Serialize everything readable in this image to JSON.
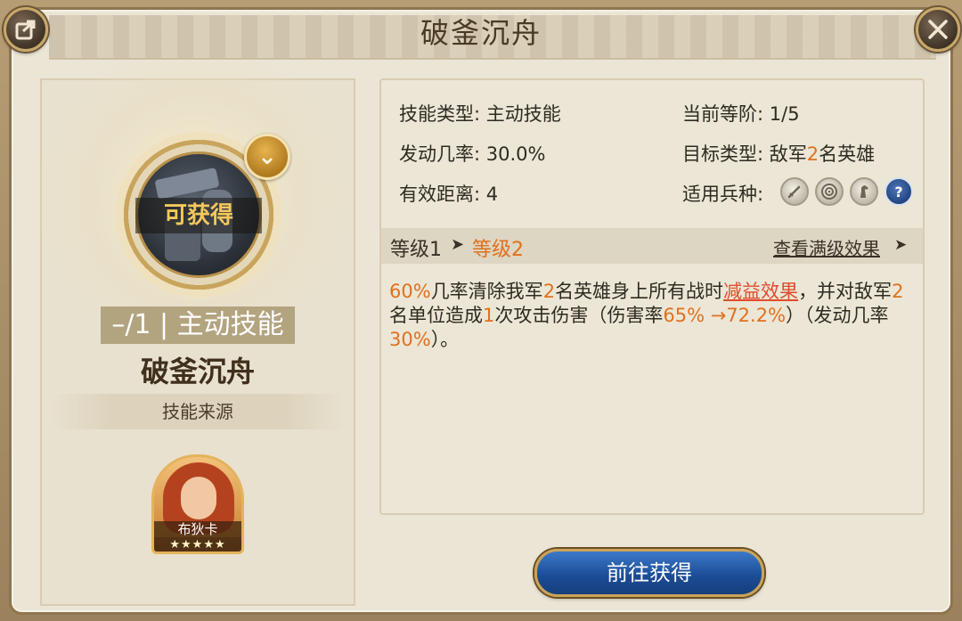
{
  "title": "破釜沉舟",
  "skill": {
    "status": "可获得",
    "level_tag": "–/1 | 主动技能",
    "name": "破釜沉舟",
    "source_label": "技能来源"
  },
  "hero": {
    "name": "布狄卡",
    "stars": "★★★★★"
  },
  "info": {
    "type_label": "技能类型:",
    "type_value": "主动技能",
    "stage_label": "当前等阶:",
    "stage_value": "1/5",
    "rate_label": "发动几率:",
    "rate_value": "30.0%",
    "target_label": "目标类型:",
    "target_pre": "敌军",
    "target_num": "2",
    "target_post": "名英雄",
    "range_label": "有效距离:",
    "range_value": "4",
    "troop_label": "适用兵种:",
    "troop_icons": [
      "sword-icon",
      "target-icon",
      "horse-icon",
      "question-icon"
    ]
  },
  "levels": {
    "from": "等级1",
    "arrow": "➤",
    "to": "等级2",
    "view_full": "查看满级效果",
    "view_arrow": "➤"
  },
  "description": {
    "p1": "60%",
    "p2": "几率清除我军",
    "p3": "2",
    "p4": "名英雄身上所有战时",
    "p5": "减益效果",
    "p6": "，并对敌军",
    "p7": "2",
    "p8": "名单位造成",
    "p9": "1",
    "p10": "次攻击伤害（伤害率",
    "p11": "65% →72.2%",
    "p12": "）（发动几率",
    "p13": "30%",
    "p14": "）。"
  },
  "go_button": "前往获得",
  "colors": {
    "highlight": "#e0701e",
    "debuff": "#e04b2c",
    "button": "#1a4b94"
  }
}
